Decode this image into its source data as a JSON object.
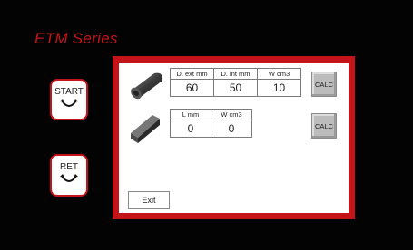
{
  "app": {
    "title": "ETM Series"
  },
  "side": {
    "start_label": "START",
    "ret_label": "RET"
  },
  "tube": {
    "headers": [
      "D. ext mm",
      "D. int mm",
      "W cm3"
    ],
    "values": [
      "60",
      "50",
      "10"
    ],
    "calc_label": "CALC"
  },
  "bar": {
    "headers": [
      "L mm",
      "W cm3"
    ],
    "values": [
      "0",
      "0"
    ],
    "calc_label": "CALC"
  },
  "footer": {
    "exit_label": "Exit"
  },
  "colors": {
    "accent": "#c4141a",
    "background": "#050505",
    "button_gray": "#bcbcbc"
  },
  "icons": {
    "start": "curved-arrow-down-icon",
    "ret": "curved-arrow-down-icon",
    "tube": "cylinder-icon",
    "bar": "square-bar-icon"
  }
}
